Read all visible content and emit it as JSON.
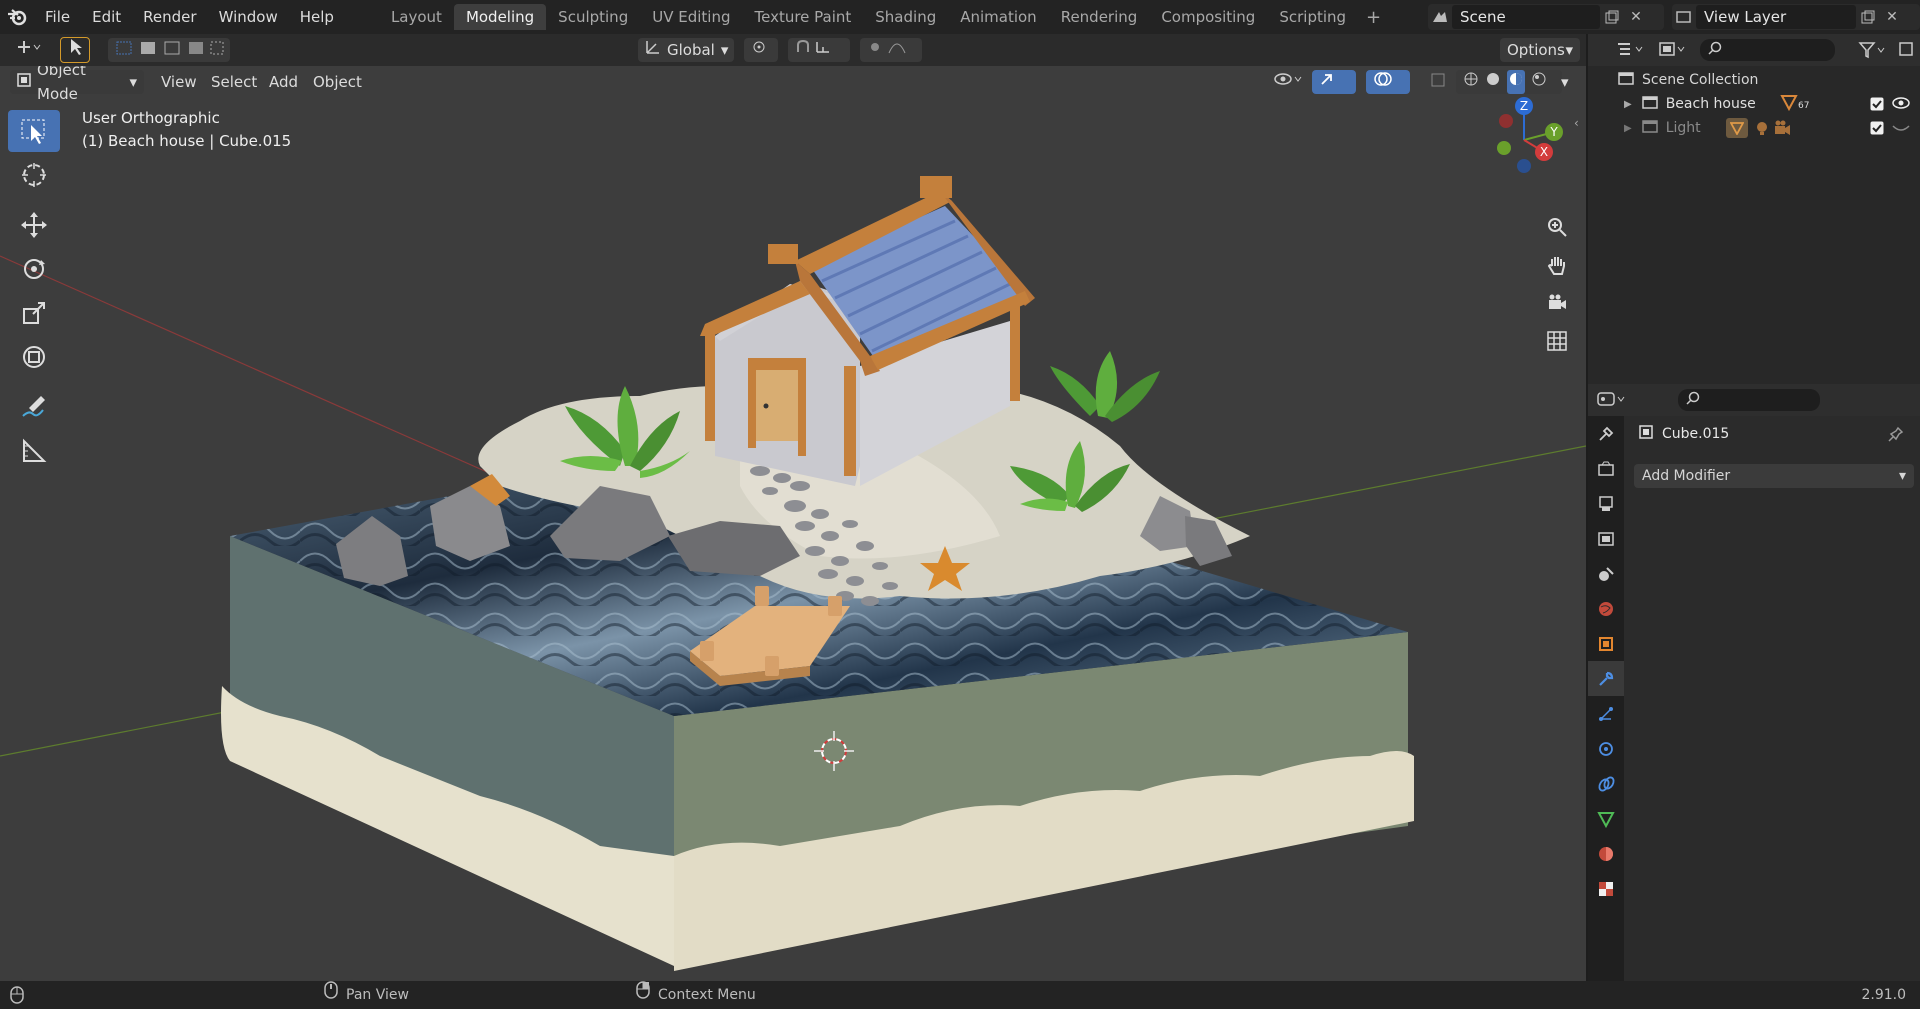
{
  "topbar": {
    "menus": [
      "File",
      "Edit",
      "Render",
      "Window",
      "Help"
    ],
    "workspaces": [
      {
        "label": "Layout",
        "active": false
      },
      {
        "label": "Modeling",
        "active": true
      },
      {
        "label": "Sculpting",
        "active": false
      },
      {
        "label": "UV Editing",
        "active": false
      },
      {
        "label": "Texture Paint",
        "active": false
      },
      {
        "label": "Shading",
        "active": false
      },
      {
        "label": "Animation",
        "active": false
      },
      {
        "label": "Rendering",
        "active": false
      },
      {
        "label": "Compositing",
        "active": false
      },
      {
        "label": "Scripting",
        "active": false
      }
    ],
    "add_workspace": "+",
    "scene_name": "Scene",
    "view_layer": "View Layer"
  },
  "toolheader": {
    "orientation": "Global",
    "options": "Options"
  },
  "viewheader": {
    "mode": "Object Mode",
    "menus": [
      "View",
      "Select",
      "Add",
      "Object"
    ]
  },
  "viewport": {
    "view_name": "User Orthographic",
    "object_info": "(1) Beach house | Cube.015",
    "gizmo_axes": {
      "z": "Z",
      "y": "Y",
      "x": "X"
    }
  },
  "outliner": {
    "root": "Scene Collection",
    "items": [
      {
        "label": "Beach house",
        "badge": "67",
        "visible": true
      },
      {
        "label": "Light",
        "visible": false
      }
    ]
  },
  "properties": {
    "object_name": "Cube.015",
    "add_modifier": "Add Modifier"
  },
  "statusbar": {
    "pan": "Pan View",
    "context": "Context Menu",
    "version": "2.91.0"
  },
  "colors": {
    "accent": "#4772b3",
    "viewport_bg": "#3d3d3d",
    "active_tab": "#3e3e3e"
  }
}
